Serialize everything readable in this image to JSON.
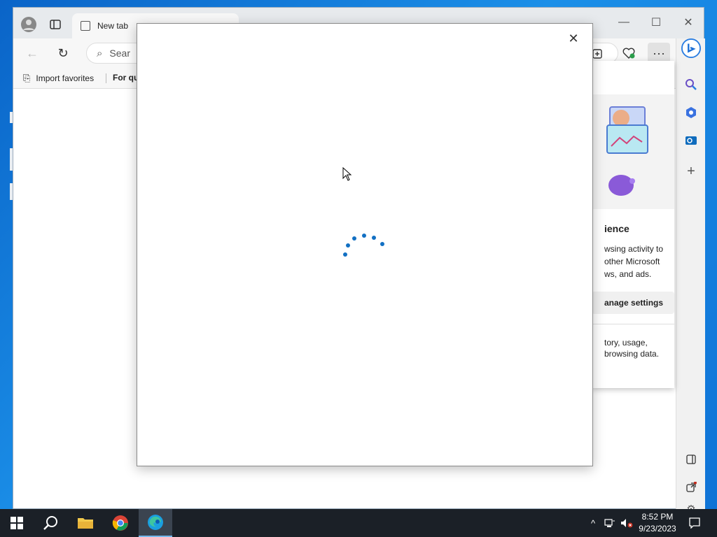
{
  "browser": {
    "tab_title": "New tab",
    "tab_close": "×",
    "address_placeholder": "Search",
    "address_visible": "Sear",
    "favorites": {
      "import_label": "Import favorites",
      "quick_label": "For qu"
    },
    "window_controls": {
      "minimize": "—",
      "maximize": "☐",
      "close": "✕"
    },
    "more": "···"
  },
  "flyout": {
    "title": "ience",
    "lines": [
      "wsing activity to",
      "other Microsoft",
      "ws, and ads."
    ],
    "button_label": "anage settings",
    "footer_lines": [
      "tory, usage,",
      "browsing data."
    ]
  },
  "dialog": {
    "close": "✕",
    "state": "loading"
  },
  "taskbar": {
    "time": "8:52 PM",
    "date": "9/23/2023"
  },
  "colors": {
    "spinner": "#1270c3",
    "taskbar": "#1b2027",
    "desktop": "#1b8fe8"
  }
}
